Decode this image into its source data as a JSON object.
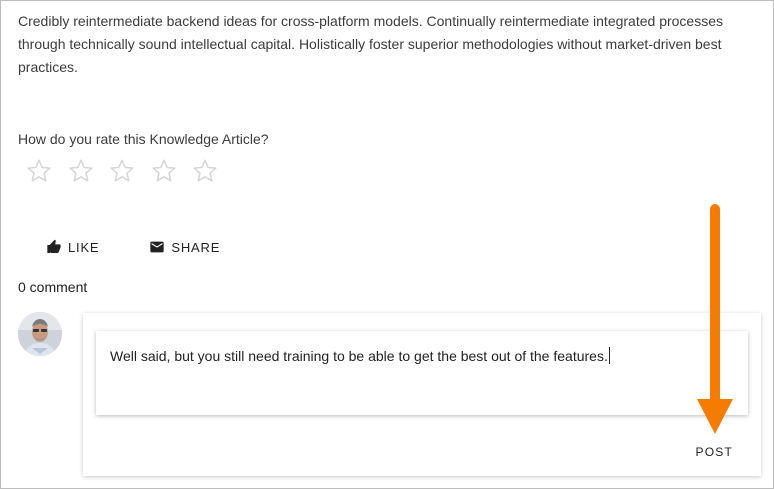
{
  "article": {
    "body": "Credibly reintermediate backend ideas for cross-platform models. Continually reintermediate integrated processes through technically sound intellectual capital. Holistically foster superior methodologies without market-driven best practices."
  },
  "rating": {
    "question": "How do you rate this Knowledge Article?",
    "max_stars": 5,
    "selected": 0
  },
  "actions": {
    "like_label": "LIKE",
    "share_label": "SHARE"
  },
  "comments": {
    "count_label": "0 comment",
    "input_value": "Well said, but you still need training to be able to get the best out of the features.",
    "post_label": "POST"
  },
  "colors": {
    "annotation_arrow": "#f57c00",
    "star_outline": "#d6d6d6"
  }
}
